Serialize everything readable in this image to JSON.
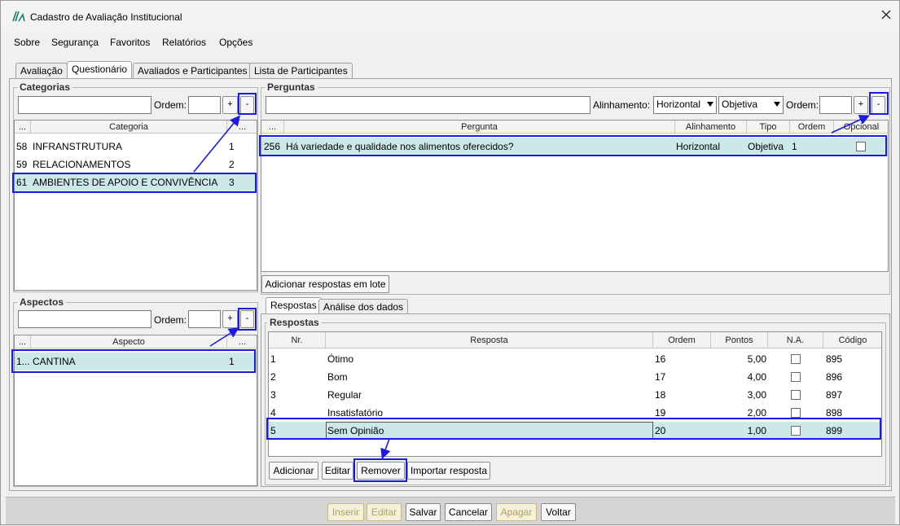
{
  "window": {
    "title": "Cadastro de Avaliação Institucional",
    "close_icon": "close-icon"
  },
  "menu": [
    "Sobre",
    "Segurança",
    "Favoritos",
    "Relatórios",
    "Opções"
  ],
  "tabs": [
    "Avaliação",
    "Questionário",
    "Avaliados e Participantes",
    "Lista de Participantes"
  ],
  "categorias": {
    "title": "Categorias",
    "ordem_label": "Ordem:",
    "plus": "+",
    "minus": "-",
    "headers": [
      "...",
      "Categoria",
      "..."
    ],
    "rows": [
      [
        "58",
        "INFRANSTRUTURA",
        "1"
      ],
      [
        "59",
        "RELACIONAMENTOS",
        "2"
      ],
      [
        "61",
        "AMBIENTES DE APOIO E CONVIVÊNCIA",
        "3"
      ]
    ]
  },
  "perguntas": {
    "title": "Perguntas",
    "alinhamento_label": "Alinhamento:",
    "alinhamento_value": "Horizontal",
    "tipo_value": "Objetiva",
    "ordem_label": "Ordem:",
    "plus": "+",
    "minus": "-",
    "headers": [
      "...",
      "Pergunta",
      "Alinhamento",
      "Tipo",
      "Ordem",
      "Opcional"
    ],
    "rows": [
      [
        "256",
        "Há variedade e qualidade nos alimentos oferecidos?",
        "Horizontal",
        "Objetiva",
        "1"
      ]
    ],
    "lote_button": "Adicionar respostas em lote"
  },
  "aspectos": {
    "title": "Aspectos",
    "ordem_label": "Ordem:",
    "plus": "+",
    "minus": "-",
    "headers": [
      "...",
      "Aspecto",
      "..."
    ],
    "rows": [
      [
        "1...",
        "CANTINA",
        "1"
      ]
    ]
  },
  "subtabs": [
    "Respostas",
    "Análise dos dados"
  ],
  "respostas": {
    "title": "Respostas",
    "headers": [
      "Nr.",
      "Resposta",
      "Ordem",
      "Pontos",
      "N.A.",
      "Código"
    ],
    "rows": [
      [
        "1",
        "Ótimo",
        "16",
        "5,00",
        "895"
      ],
      [
        "2",
        "Bom",
        "17",
        "4,00",
        "896"
      ],
      [
        "3",
        "Regular",
        "18",
        "3,00",
        "897"
      ],
      [
        "4",
        "Insatisfatório",
        "19",
        "2,00",
        "898"
      ],
      [
        "5",
        "Sem Opinião",
        "20",
        "1,00",
        "899"
      ]
    ],
    "buttons": [
      "Adicionar",
      "Editar",
      "Remover",
      "Importar resposta"
    ]
  },
  "footer": [
    "Inserir",
    "Editar",
    "Salvar",
    "Cancelar",
    "Apagar",
    "Voltar"
  ],
  "colors": {
    "highlight": "#1a1ae0",
    "selected_row": "#cde8e8"
  }
}
